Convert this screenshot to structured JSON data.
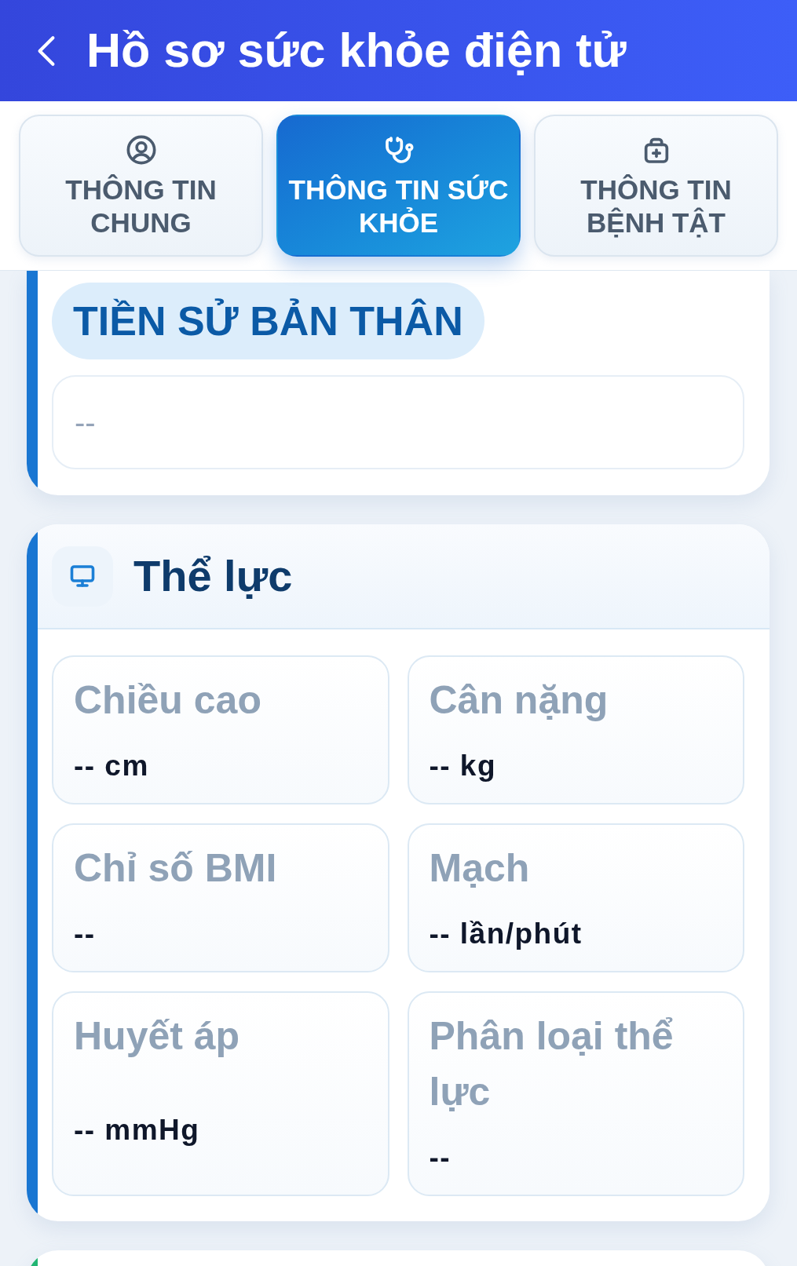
{
  "header": {
    "title": "Hồ sơ sức khỏe điện tử"
  },
  "tabs": [
    {
      "label": "THÔNG TIN CHUNG",
      "selected": false
    },
    {
      "label": "THÔNG TIN SỨC KHỎE",
      "selected": true
    },
    {
      "label": "THÔNG TIN BỆNH TẬT",
      "selected": false
    }
  ],
  "sections": [
    {
      "kind": "text",
      "title": "TIỀN SỬ BẢN THÂN",
      "value": "--",
      "color": "#1976d2"
    },
    {
      "kind": "grid",
      "title": "Thể lực",
      "color": "#1976d2",
      "fields": [
        {
          "label": "Chiều cao",
          "value": "-- cm"
        },
        {
          "label": "Cân nặng",
          "value": "-- kg"
        },
        {
          "label": "Chỉ số BMI",
          "value": "--"
        },
        {
          "label": "Mạch",
          "value": "-- lần/phút"
        },
        {
          "label": "Huyết áp",
          "value": "-- mmHg"
        },
        {
          "label": "Phân loại thể lực",
          "value": "--"
        }
      ]
    },
    {
      "color": "#22b573"
    }
  ]
}
